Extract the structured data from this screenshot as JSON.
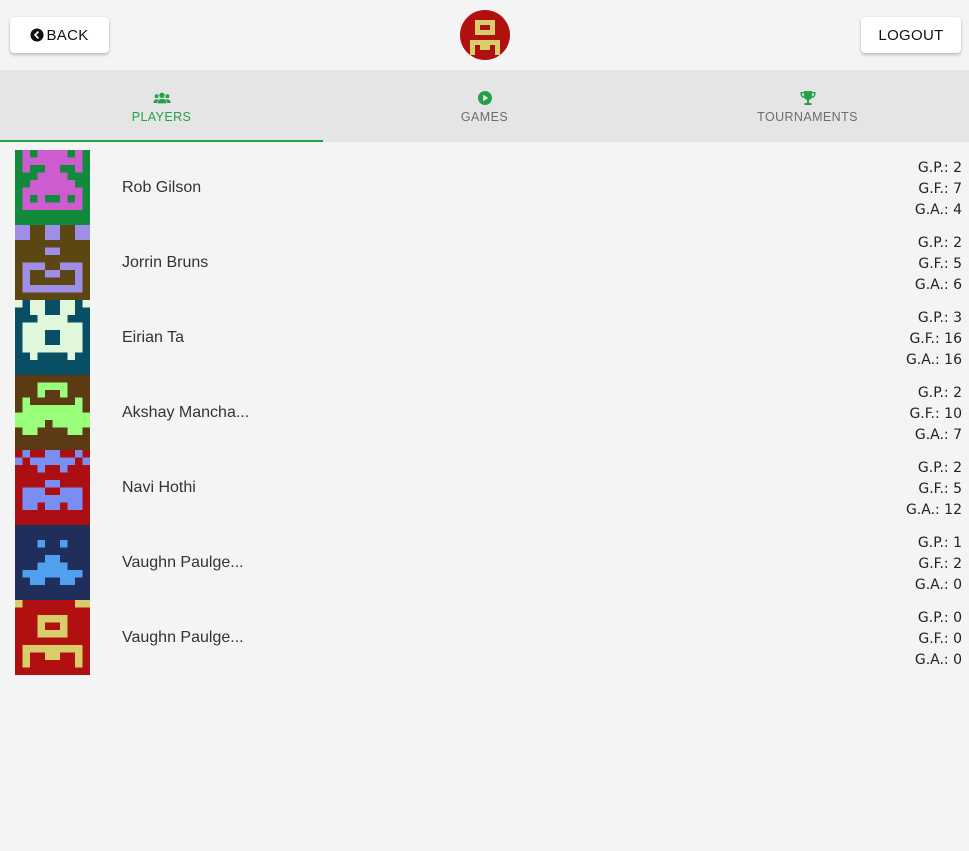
{
  "header": {
    "back_label": "BACK",
    "logout_label": "LOGOUT"
  },
  "tabs": [
    {
      "label": "PLAYERS",
      "icon": "users-icon",
      "active": true
    },
    {
      "label": "GAMES",
      "icon": "play-icon",
      "active": false
    },
    {
      "label": "TOURNAMENTS",
      "icon": "trophy-icon",
      "active": false
    }
  ],
  "colors": {
    "accent": "#24a148",
    "logo_bg": "#b0100f",
    "logo_fg": "#d7cd6b"
  },
  "players": [
    {
      "name": "Rob Gilson",
      "gp": "G.P.: 2",
      "gf": "G.F.: 7",
      "ga": "G.A.: 4",
      "bg": "#128a3b",
      "fg": "#cc5cd0"
    },
    {
      "name": "Jorrin Bruns",
      "gp": "G.P.: 2",
      "gf": "G.F.: 5",
      "ga": "G.A.: 6",
      "bg": "#5c4712",
      "fg": "#9f8ee6"
    },
    {
      "name": "Eirian Ta",
      "gp": "G.P.: 3",
      "gf": "G.F.: 16",
      "ga": "G.A.: 16",
      "bg": "#084f65",
      "fg": "#e0f7dc"
    },
    {
      "name": "Akshay Mancha...",
      "gp": "G.P.: 2",
      "gf": "G.F.: 10",
      "ga": "G.A.: 7",
      "bg": "#5b3a14",
      "fg": "#99ff7a"
    },
    {
      "name": "Navi Hothi",
      "gp": "G.P.: 2",
      "gf": "G.F.: 5",
      "ga": "G.A.: 12",
      "bg": "#ac0f12",
      "fg": "#7b8ef4"
    },
    {
      "name": "Vaughn Paulge...",
      "gp": "G.P.: 1",
      "gf": "G.F.: 2",
      "ga": "G.A.: 0",
      "bg": "#1f2e5a",
      "fg": "#4fa0ee"
    },
    {
      "name": "Vaughn Paulge...",
      "gp": "G.P.: 0",
      "gf": "G.F.: 0",
      "ga": "G.A.: 0",
      "bg": "#b0100f",
      "fg": "#d7cd6b"
    }
  ]
}
